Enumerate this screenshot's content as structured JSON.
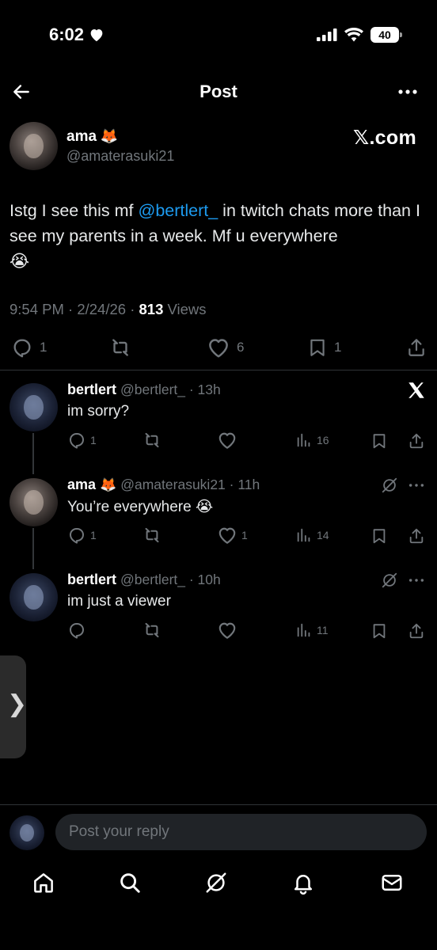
{
  "status_bar": {
    "time": "6:02",
    "battery": "40"
  },
  "header": {
    "title": "Post"
  },
  "post": {
    "author_name": "ama",
    "author_emoji": "🦊",
    "author_handle": "@amaterasuki21",
    "watermark": "𝕏.com",
    "text_before": "Istg I see this mf ",
    "mention": "@bertlert_",
    "text_after": " in twitch chats more than I see my parents in a week. Mf u everywhere",
    "text_emoji": "😭",
    "time": "9:54 PM · 2/24/26 · ",
    "views_count": "813",
    "views_label": " Views",
    "replies": "1",
    "likes": "6",
    "bookmarks": "1"
  },
  "replies": [
    {
      "name": "bertlert",
      "emoji": "",
      "handle": "@bertlert_ · 13h",
      "text": "im sorry?",
      "text_emoji": "",
      "reply_count": "1",
      "like_count": "",
      "views": "16"
    },
    {
      "name": "ama",
      "emoji": "🦊",
      "handle": "@amaterasuki21 · 11h",
      "text": "You’re everywhere",
      "text_emoji": "😭",
      "reply_count": "1",
      "like_count": "1",
      "views": "14"
    },
    {
      "name": "bertlert",
      "emoji": "",
      "handle": "@bertlert_ · 10h",
      "text": "im just a viewer",
      "text_emoji": "",
      "reply_count": "",
      "like_count": "",
      "views": "11"
    }
  ],
  "composer": {
    "placeholder": "Post your reply"
  },
  "side_handle": "❯",
  "colors": {
    "accent": "#1d9bf0",
    "muted": "#71767b",
    "background": "#000000"
  },
  "icons": [
    "back-arrow-icon",
    "more-icon",
    "reply-icon",
    "retweet-icon",
    "like-icon",
    "bookmark-icon",
    "share-icon",
    "views-icon",
    "grok-icon",
    "x-logo-icon",
    "home-icon",
    "search-icon",
    "notifications-icon",
    "messages-icon"
  ]
}
